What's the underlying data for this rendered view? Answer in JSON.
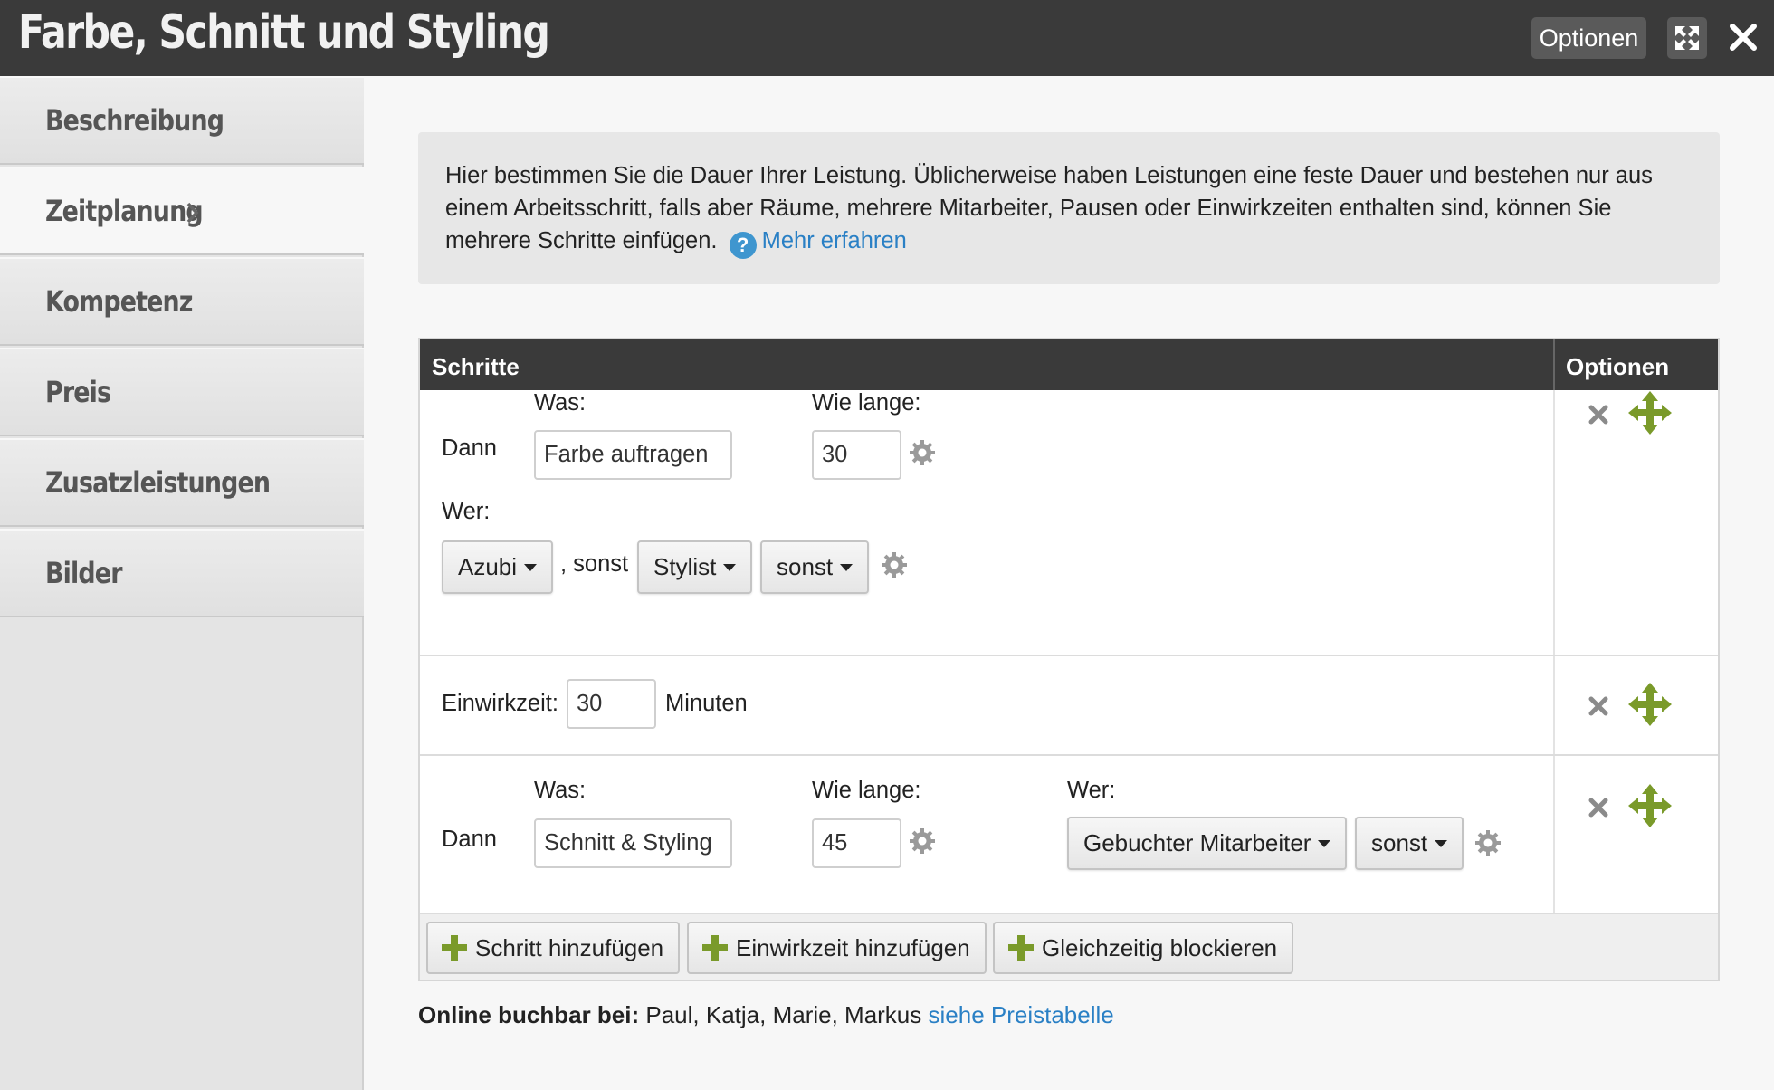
{
  "window": {
    "title": "Farbe, Schnitt und Styling",
    "options_label": "Optionen"
  },
  "sidebar": {
    "items": [
      {
        "label": "Beschreibung"
      },
      {
        "label": "Zeitplanung"
      },
      {
        "label": "Kompetenz"
      },
      {
        "label": "Preis"
      },
      {
        "label": "Zusatzleistungen"
      },
      {
        "label": "Bilder"
      }
    ],
    "active": "Zeitplanung"
  },
  "info": {
    "text": "Hier bestimmen Sie die Dauer Ihrer Leistung. Üblicherweise haben Leistungen eine feste Dauer und bestehen nur aus einem Arbeitsschritt, falls aber Räume, mehrere Mitarbeiter, Pausen oder Einwirkzeiten enthalten sind, können Sie mehrere Schritte einfügen.",
    "help_icon": "?",
    "link": "Mehr erfahren"
  },
  "table": {
    "col_steps": "Schritte",
    "col_options": "Optionen",
    "step1": {
      "prefix": "Dann",
      "was_label": "Was:",
      "was_value": "Farbe auftragen",
      "duration_label": "Wie lange:",
      "duration_value": "30",
      "wer_label": "Wer:",
      "wer_primary": "Azubi",
      "sonst_text": ", sonst",
      "wer_secondary": "Stylist",
      "wer_third": "sonst"
    },
    "pause": {
      "label": "Einwirkzeit:",
      "value": "30",
      "unit": "Minuten"
    },
    "step2": {
      "prefix": "Dann",
      "was_label": "Was:",
      "was_value": "Schnitt & Styling",
      "duration_label": "Wie lange:",
      "duration_value": "45",
      "wer_label": "Wer:",
      "wer_primary": "Gebuchter Mitarbeiter",
      "wer_secondary": "sonst"
    },
    "buttons": {
      "add_step": "Schritt hinzufügen",
      "add_pause": "Einwirkzeit hinzufügen",
      "block": "Gleichzeitig blockieren"
    }
  },
  "online": {
    "label": "Online buchbar bei:",
    "names": "Paul, Katja, Marie, Markus",
    "link": "siehe Preistabelle"
  },
  "colors": {
    "header_bg": "#3a3a3a",
    "accent_green": "#7a9a2a",
    "link_blue": "#2a80c5"
  }
}
